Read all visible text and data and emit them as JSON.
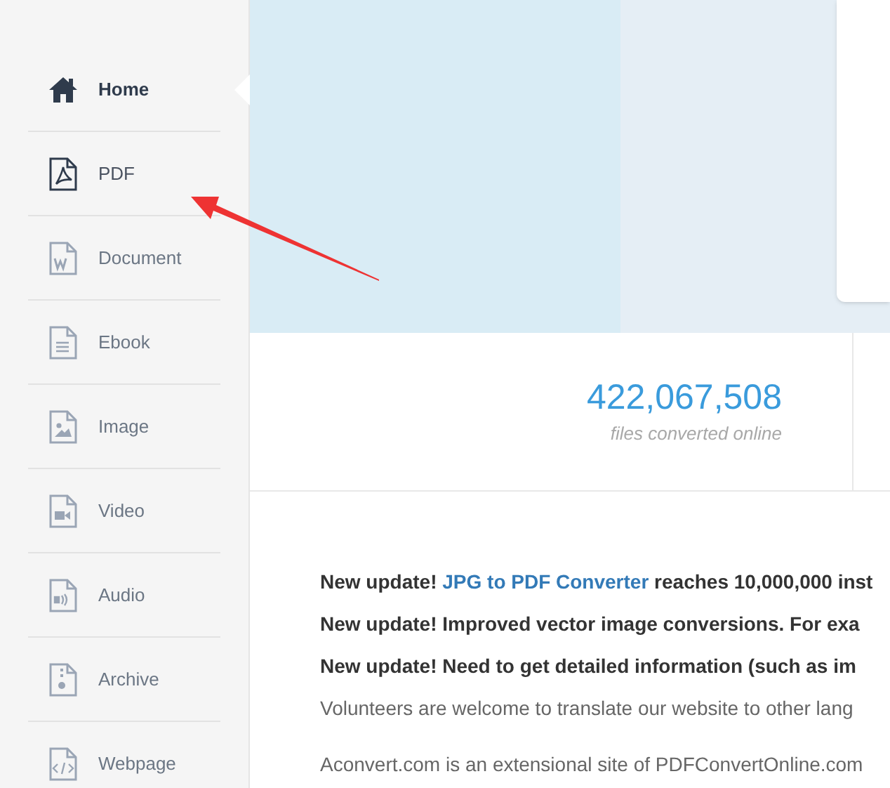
{
  "sidebar": {
    "items": [
      {
        "label": "Home",
        "selected": true,
        "highlighted": false
      },
      {
        "label": "PDF",
        "selected": false,
        "highlighted": true
      },
      {
        "label": "Document",
        "selected": false,
        "highlighted": false
      },
      {
        "label": "Ebook",
        "selected": false,
        "highlighted": false
      },
      {
        "label": "Image",
        "selected": false,
        "highlighted": false
      },
      {
        "label": "Video",
        "selected": false,
        "highlighted": false
      },
      {
        "label": "Audio",
        "selected": false,
        "highlighted": false
      },
      {
        "label": "Archive",
        "selected": false,
        "highlighted": false
      },
      {
        "label": "Webpage",
        "selected": false,
        "highlighted": false
      }
    ]
  },
  "stats": {
    "count": "422,067,508",
    "caption": "files converted online"
  },
  "news": [
    {
      "kind": "update",
      "lead": "New update!",
      "link": "JPG to PDF Converter",
      "rest": "reaches 10,000,000 inst"
    },
    {
      "kind": "update",
      "lead": "New update!",
      "rest": "Improved vector image conversions. For exa"
    },
    {
      "kind": "update",
      "lead": "New update!",
      "rest": "Need to get detailed information (such as im"
    },
    {
      "kind": "plain",
      "rest": "Volunteers are welcome to translate our website to other lang"
    },
    {
      "kind": "para",
      "rest": "Aconvert.com is an extensional site of PDFConvertOnline.com"
    }
  ]
}
